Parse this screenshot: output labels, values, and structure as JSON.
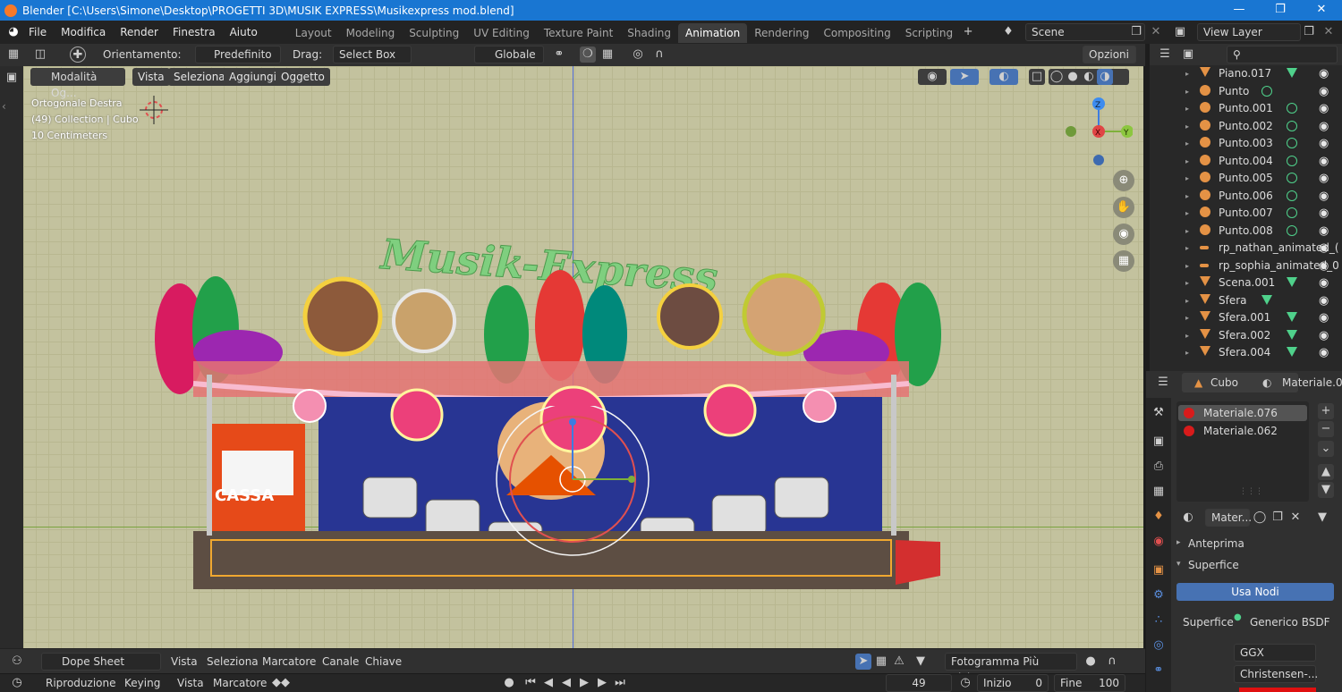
{
  "window": {
    "title": "Blender [C:\\Users\\Simone\\Desktop\\PROGETTI 3D\\MUSIK EXPRESS\\Musikexpress mod.blend]"
  },
  "menu": [
    "File",
    "Modifica",
    "Render",
    "Finestra",
    "Aiuto"
  ],
  "workspace_tabs": [
    "Layout",
    "Modeling",
    "Sculpting",
    "UV Editing",
    "Texture Paint",
    "Shading",
    "Animation",
    "Rendering",
    "Compositing",
    "Scripting"
  ],
  "active_workspace": "Animation",
  "scene": {
    "name": "Scene",
    "view_layer": "View Layer"
  },
  "tool_header": {
    "orient_label": "Orientamento:",
    "orient_value": "Predefinito",
    "drag_label": "Drag:",
    "drag_value": "Select Box",
    "transform_orient": "Globale",
    "options": "Opzioni"
  },
  "viewport_header": {
    "mode": "Modalità Og...",
    "items": [
      "Vista",
      "Seleziona",
      "Aggiungi",
      "Oggetto"
    ]
  },
  "viewport_overlay": {
    "view_name": "Ortogonale Destra",
    "collection": "(49) Collection | Cubo",
    "scale": "10 Centimeters"
  },
  "gizmo": {
    "z": "Z",
    "x": "X",
    "y": "Y"
  },
  "scene_art": {
    "logo_text": "Musik-Express",
    "booth_text": "CASSA"
  },
  "outliner": [
    {
      "name": "Piano.017",
      "type": "mesh",
      "data": "mesh"
    },
    {
      "name": "Punto",
      "type": "light",
      "data": "light"
    },
    {
      "name": "Punto.001",
      "type": "light",
      "data": "light"
    },
    {
      "name": "Punto.002",
      "type": "light",
      "data": "light"
    },
    {
      "name": "Punto.003",
      "type": "light",
      "data": "light"
    },
    {
      "name": "Punto.004",
      "type": "light",
      "data": "light"
    },
    {
      "name": "Punto.005",
      "type": "light",
      "data": "light"
    },
    {
      "name": "Punto.006",
      "type": "light",
      "data": "light"
    },
    {
      "name": "Punto.007",
      "type": "light",
      "data": "light"
    },
    {
      "name": "Punto.008",
      "type": "light",
      "data": "light"
    },
    {
      "name": "rp_nathan_animated_(",
      "type": "armature",
      "data": ""
    },
    {
      "name": "rp_sophia_animated_0",
      "type": "armature",
      "data": ""
    },
    {
      "name": "Scena.001",
      "type": "mesh",
      "data": "mesh"
    },
    {
      "name": "Sfera",
      "type": "mesh",
      "data": "mesh"
    },
    {
      "name": "Sfera.001",
      "type": "mesh",
      "data": "mesh"
    },
    {
      "name": "Sfera.002",
      "type": "mesh",
      "data": "mesh"
    },
    {
      "name": "Sfera.004",
      "type": "mesh",
      "data": "mesh"
    }
  ],
  "properties": {
    "object": "Cubo",
    "material_name": "Materiale.076",
    "slots": [
      "Materiale.076",
      "Materiale.062"
    ],
    "slot_colors": [
      "#d81b1b",
      "#d81b1b"
    ],
    "material_field": "Mater...",
    "preview": "Anteprima",
    "surface_section": "Superfice",
    "use_nodes": "Usa Nodi",
    "surface_label": "Superfice",
    "surface_value": "Generico BSDF",
    "distribution": "GGX",
    "subsurface": "Christensen-..."
  },
  "dope_sheet": {
    "mode": "Dope Sheet",
    "menus": [
      "Vista",
      "Seleziona",
      "Marcatore",
      "Canale",
      "Chiave"
    ],
    "snap": "Fotogramma Più Vicino"
  },
  "timeline": {
    "menus": [
      "Riproduzione",
      "Keying",
      "Vista",
      "Marcatore"
    ],
    "current_frame": "49",
    "start_label": "Inizio",
    "start_value": "0",
    "end_label": "Fine",
    "end_value": "100"
  },
  "colors": {
    "accent": "#4772b3",
    "viewport_bg": "#c3c29e",
    "titlebar": "#1976d2"
  }
}
